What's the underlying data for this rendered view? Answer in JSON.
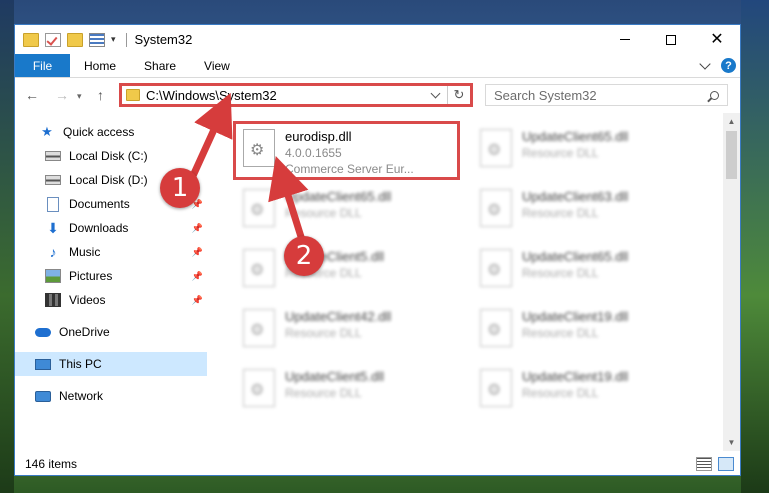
{
  "titlebar": {
    "title": "System32",
    "qat_dropdown": "▾"
  },
  "ribbon": {
    "tabs": [
      "File",
      "Home",
      "Share",
      "View"
    ],
    "help": "?"
  },
  "nav": {
    "back": "←",
    "forward": "→",
    "recent": "▾",
    "up": "↑",
    "address": "C:\\Windows\\System32",
    "refresh": "↻",
    "search_placeholder": "Search System32"
  },
  "sidebar": {
    "items": [
      {
        "label": "Quick access",
        "icon": "star-icon"
      },
      {
        "label": "Local Disk (C:)",
        "icon": "drive-icon"
      },
      {
        "label": "Local Disk (D:)",
        "icon": "drive-icon"
      },
      {
        "label": "Documents",
        "icon": "documents-icon",
        "pinned": true
      },
      {
        "label": "Downloads",
        "icon": "downloads-icon",
        "pinned": true
      },
      {
        "label": "Music",
        "icon": "music-icon",
        "pinned": true
      },
      {
        "label": "Pictures",
        "icon": "pictures-icon",
        "pinned": true
      },
      {
        "label": "Videos",
        "icon": "videos-icon",
        "pinned": true
      },
      {
        "label": "OneDrive",
        "icon": "onedrive-icon"
      },
      {
        "label": "This PC",
        "icon": "this-pc-icon",
        "selected": true
      },
      {
        "label": "Network",
        "icon": "network-icon"
      }
    ],
    "pin_glyph": "📌"
  },
  "files": {
    "left": [
      {
        "name": "eurodisp.dll",
        "line2": "4.0.0.1655",
        "line3": "Commerce Server Eur..."
      },
      {
        "name": "UpdateClient65.dll",
        "line2": "Resource DLL"
      },
      {
        "name": "UpdateClient5.dll",
        "line2": "Resource DLL"
      },
      {
        "name": "UpdateClient42.dll",
        "line2": "Resource DLL"
      },
      {
        "name": "UpdateClient5.dll",
        "line2": "Resource DLL"
      }
    ],
    "right": [
      {
        "name": "UpdateClient65.dll",
        "line2": "Resource DLL"
      },
      {
        "name": "UpdateClient63.dll",
        "line2": "Resource DLL"
      },
      {
        "name": "UpdateClient65.dll",
        "line2": "Resource DLL"
      },
      {
        "name": "UpdateClient19.dll",
        "line2": "Resource DLL"
      },
      {
        "name": "UpdateClient19.dll",
        "line2": "Resource DLL"
      }
    ]
  },
  "status": {
    "count": "146 items"
  },
  "callouts": [
    "1",
    "2"
  ],
  "colors": {
    "accent": "#1979ca",
    "highlight": "#d94a4a",
    "selection": "#cde8ff"
  }
}
